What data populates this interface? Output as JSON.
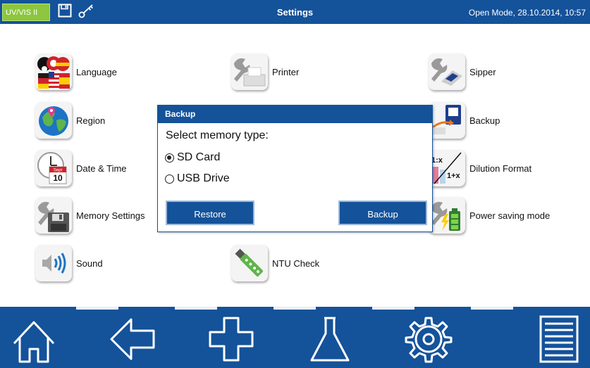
{
  "header": {
    "mode": "UV/VIS II",
    "title": "Settings",
    "status": "Open Mode, 28.10.2014, 10:57"
  },
  "settings": {
    "language": "Language",
    "printer": "Printer",
    "sipper": "Sipper",
    "region": "Region",
    "backup": "Backup",
    "date_time": "Date & Time",
    "date_icon_month": "Sept",
    "date_icon_day": "10",
    "dilution_format": "Dilution Format",
    "dilution_icon_top": "1:x",
    "dilution_icon_bottom": "1+x",
    "memory_settings": "Memory Settings",
    "power_saving": "Power saving mode",
    "sound": "Sound",
    "ntu_check": "NTU Check"
  },
  "dialog": {
    "title": "Backup",
    "prompt": "Select memory type:",
    "options": [
      {
        "label": "SD Card",
        "selected": true
      },
      {
        "label": "USB Drive",
        "selected": false
      }
    ],
    "restore_label": "Restore",
    "backup_label": "Backup"
  },
  "nav": {
    "icons": [
      "home-icon",
      "back-arrow-icon",
      "plus-icon",
      "flask-icon",
      "gear-icon",
      "menu-list-icon"
    ]
  },
  "colors": {
    "brand_blue": "#14529a",
    "mode_green": "#8cc63f"
  }
}
